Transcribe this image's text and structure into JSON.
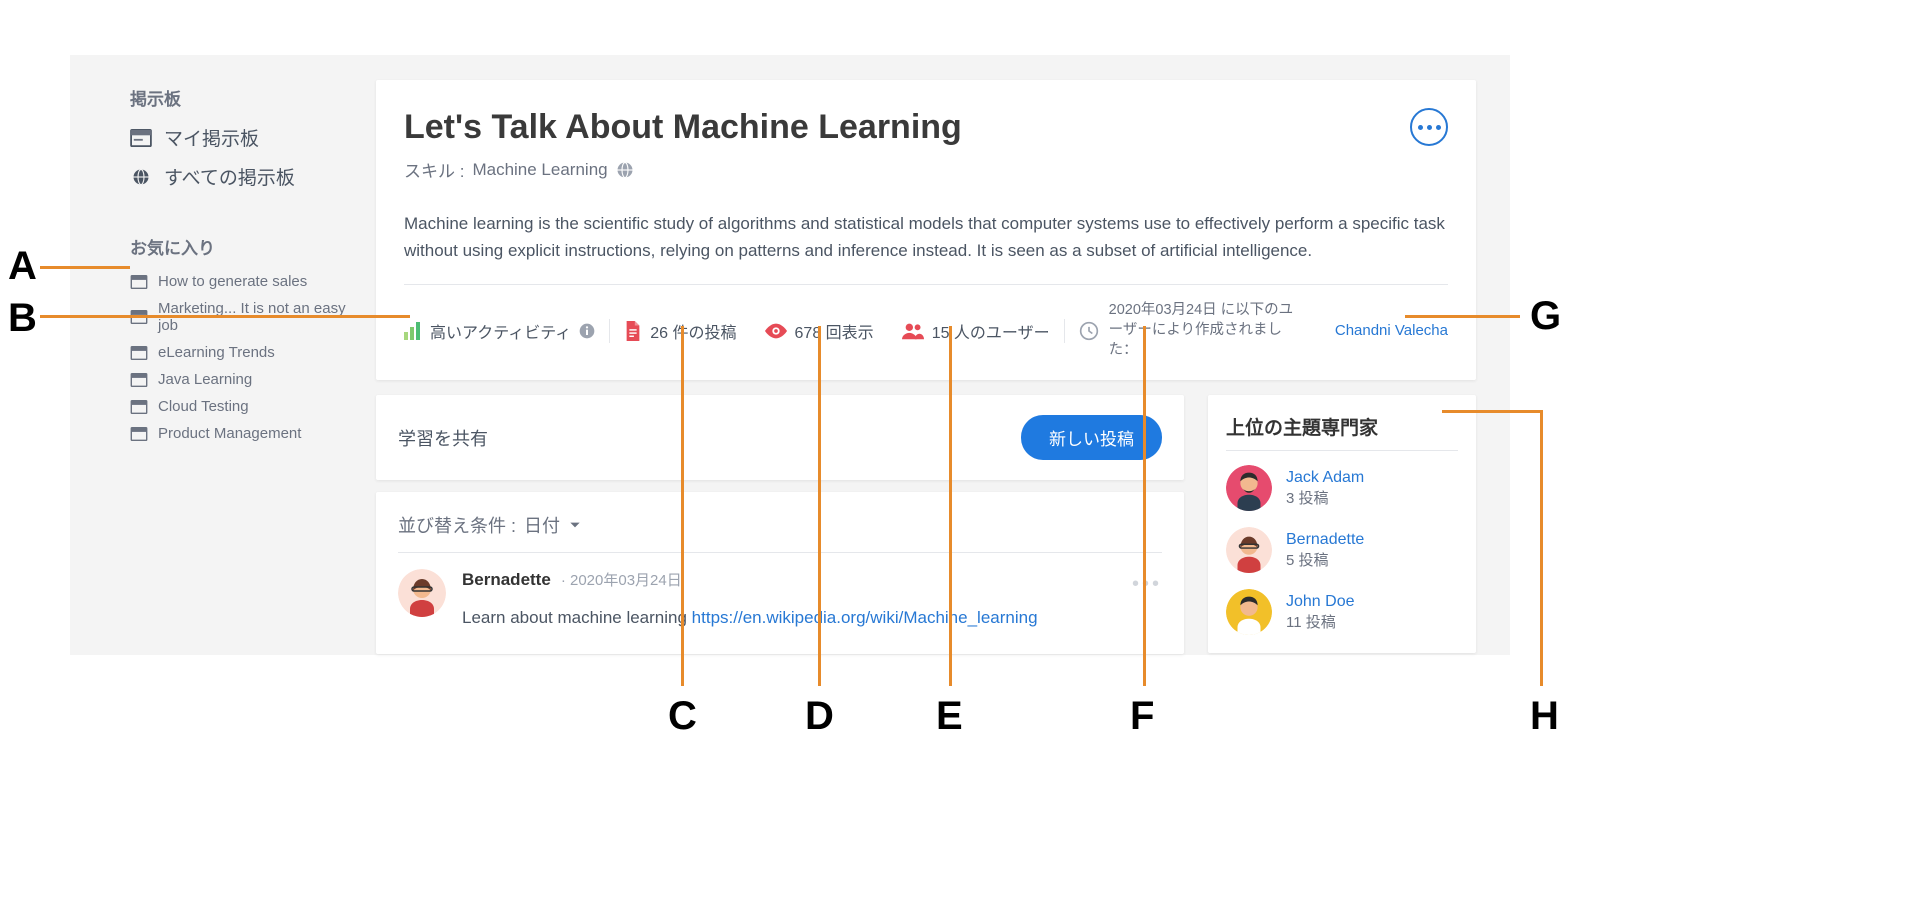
{
  "sidebar": {
    "head1": "掲示板",
    "my_boards": "マイ掲示板",
    "all_boards": "すべての掲示板",
    "head2": "お気に入り",
    "favorites": [
      "How to generate sales",
      "Marketing... It is not an easy job",
      "eLearning Trends",
      "Java Learning",
      "Cloud Testing",
      "Product Management"
    ]
  },
  "board": {
    "title": "Let's Talk About Machine Learning",
    "skill_label": "スキル :",
    "skill": "Machine Learning",
    "description": "Machine learning is the scientific study of algorithms and statistical models that computer systems use to effectively perform a specific task without using explicit instructions, relying on patterns and inference instead. It is seen as a subset of artificial intelligence.",
    "activity_level": "高いアクティビティ",
    "posts_stat": "26 件の投稿",
    "views_stat": "678 回表示",
    "users_stat": "15 人のユーザー",
    "created_text": "2020年03月24日 に以下のユーザーにより作成されました：",
    "creator": "Chandni Valecha"
  },
  "share": {
    "label": "学習を共有",
    "new_post": "新しい投稿"
  },
  "feed": {
    "sort_prefix": "並び替え条件 :",
    "sort_value": "日付",
    "post": {
      "author": "Bernadette",
      "date": "2020年03月24日",
      "text": "Learn about machine learning ",
      "link": "https://en.wikipedia.org/wiki/Machine_learning"
    }
  },
  "experts": {
    "title": "上位の主題専門家",
    "post_suffix": "投稿",
    "list": [
      {
        "name": "Jack Adam",
        "posts": "3"
      },
      {
        "name": "Bernadette",
        "posts": "5"
      },
      {
        "name": "John Doe",
        "posts": "11"
      }
    ]
  },
  "annotations": {
    "A": "A",
    "B": "B",
    "C": "C",
    "D": "D",
    "E": "E",
    "F": "F",
    "G": "G",
    "H": "H"
  }
}
